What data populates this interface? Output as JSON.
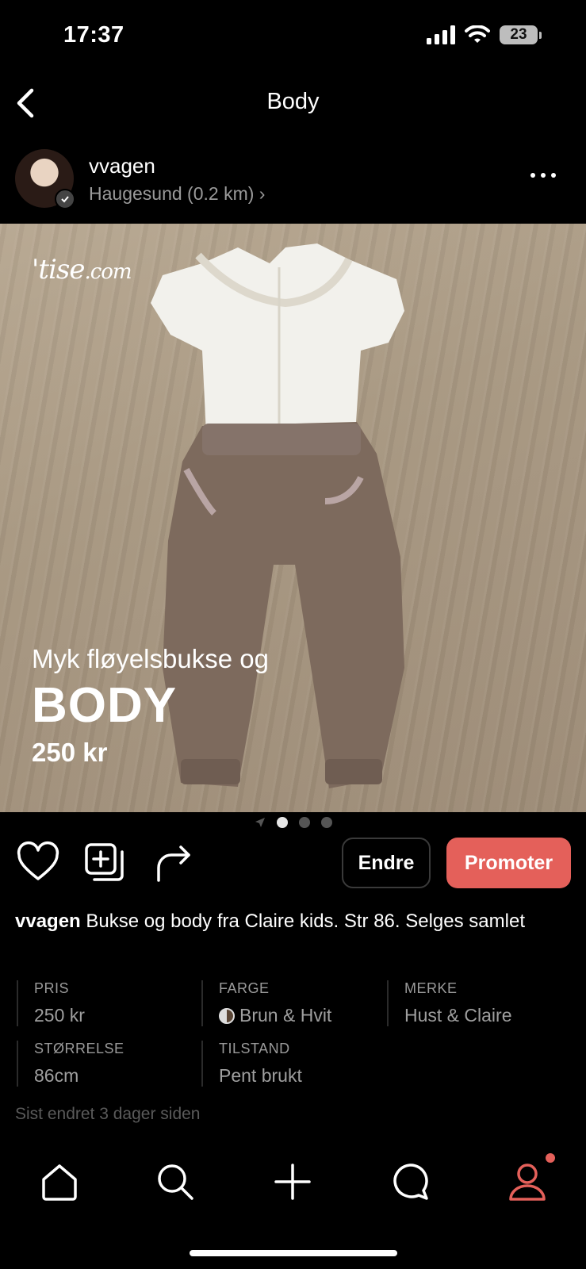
{
  "status_bar": {
    "time": "17:37",
    "battery": "23"
  },
  "nav": {
    "title": "Body"
  },
  "seller": {
    "username": "vvagen",
    "location": "Haugesund (0.2 km)"
  },
  "photo": {
    "watermark": "'tise",
    "watermark_domain": ".com",
    "overlay_line1": "Myk fløyelsbukse og",
    "overlay_line2": "BODY",
    "overlay_line3": "250 kr",
    "page_count": 3,
    "active_page": 1
  },
  "actions": {
    "edit_label": "Endre",
    "promote_label": "Promoter"
  },
  "caption": {
    "username": "vvagen",
    "text": " Bukse og body fra Claire kids.  Str 86. Selges samlet"
  },
  "details": {
    "price": {
      "label": "PRIS",
      "value": "250 kr"
    },
    "color": {
      "label": "FARGE",
      "value": "Brun & Hvit"
    },
    "brand": {
      "label": "MERKE",
      "value": "Hust & Claire"
    },
    "size": {
      "label": "STØRRELSE",
      "value": "86cm"
    },
    "condition": {
      "label": "TILSTAND",
      "value": "Pent brukt"
    }
  },
  "updated": "Sist endret 3 dager siden",
  "colors": {
    "accent": "#e4605a",
    "background": "#000000",
    "muted": "#9a9a9a"
  },
  "tabbar": [
    "home-icon",
    "search-icon",
    "plus-icon",
    "chat-icon",
    "profile-icon"
  ]
}
